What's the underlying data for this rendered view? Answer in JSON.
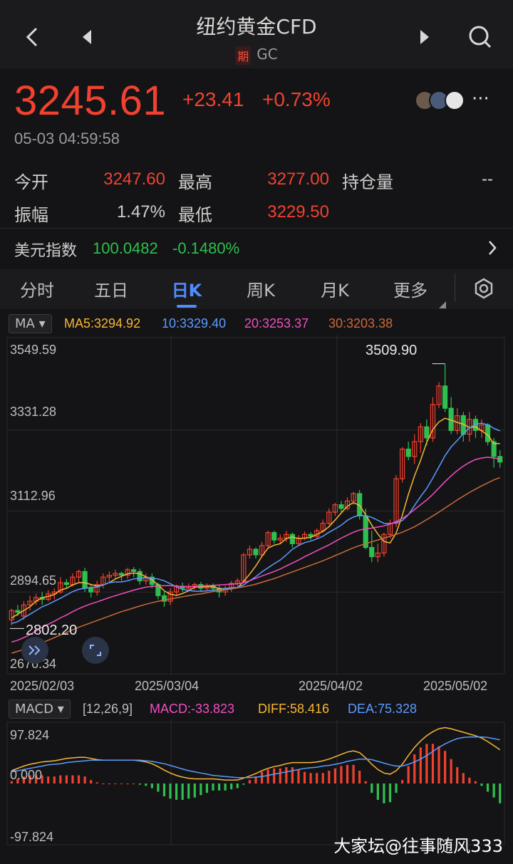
{
  "header": {
    "title": "纽约黄金CFD",
    "badge": "期",
    "code": "GC"
  },
  "quote": {
    "price": "3245.61",
    "change": "+23.41",
    "change_pct": "+0.73%",
    "timestamp": "05-03 04:59:58",
    "more": "···"
  },
  "stats": {
    "open_label": "今开",
    "open": "3247.60",
    "high_label": "最高",
    "high": "3277.00",
    "oi_label": "持仓量",
    "oi": "--",
    "amp_label": "振幅",
    "amp": "1.47%",
    "low_label": "最低",
    "low": "3229.50"
  },
  "related": {
    "label": "美元指数",
    "value": "100.0482",
    "change": "-0.1480%"
  },
  "tabs": [
    {
      "label": "分时"
    },
    {
      "label": "五日"
    },
    {
      "label": "日K"
    },
    {
      "label": "周K"
    },
    {
      "label": "月K"
    },
    {
      "label": "更多"
    }
  ],
  "main_indicator": {
    "selector": "MA",
    "ma5": "MA5:3294.92",
    "ma10": "10:3329.40",
    "ma20": "20:3253.37",
    "ma30": "30:3203.38"
  },
  "sub_indicator": {
    "selector": "MACD",
    "params": "[12,26,9]",
    "macd": "MACD:-33.823",
    "diff": "DIFF:58.416",
    "dea": "DEA:75.328"
  },
  "colors": {
    "up": "#f2412f",
    "down": "#2fbf4f",
    "ma5": "#f7b733",
    "ma10": "#5b9bff",
    "ma20": "#f04fc0",
    "ma30": "#c96a3c",
    "accent": "#4e8cff"
  },
  "icons": [
    "back-icon",
    "prev-icon",
    "next-icon",
    "search-icon",
    "settings-icon",
    "chevron-right-icon",
    "collapse-icon",
    "fullscreen-icon"
  ],
  "watermark": "大家坛@往事随风333",
  "chart_data": [
    {
      "type": "candlestick",
      "y_tick_labels": [
        "3549.59",
        "3331.28",
        "3112.96",
        "2894.65",
        "2676.34"
      ],
      "ylim": [
        2676.34,
        3549.59
      ],
      "x_tick_labels": [
        "2025/02/03",
        "2025/03/04",
        "2025/04/02",
        "2025/05/02"
      ],
      "max_marker": "3509.90",
      "min_marker": "2802.20",
      "candles": [
        [
          2820,
          2845,
          2805,
          2850
        ],
        [
          2845,
          2840,
          2830,
          2860
        ],
        [
          2830,
          2860,
          2820,
          2870
        ],
        [
          2860,
          2870,
          2845,
          2885
        ],
        [
          2870,
          2880,
          2860,
          2890
        ],
        [
          2880,
          2875,
          2860,
          2895
        ],
        [
          2875,
          2890,
          2870,
          2900
        ],
        [
          2890,
          2895,
          2875,
          2905
        ],
        [
          2895,
          2920,
          2890,
          2935
        ],
        [
          2920,
          2915,
          2905,
          2930
        ],
        [
          2915,
          2935,
          2910,
          2945
        ],
        [
          2935,
          2950,
          2920,
          2955
        ],
        [
          2950,
          2905,
          2895,
          2960
        ],
        [
          2905,
          2895,
          2880,
          2915
        ],
        [
          2895,
          2915,
          2885,
          2925
        ],
        [
          2915,
          2935,
          2905,
          2945
        ],
        [
          2935,
          2940,
          2920,
          2950
        ],
        [
          2940,
          2945,
          2930,
          2955
        ],
        [
          2945,
          2940,
          2925,
          2950
        ],
        [
          2940,
          2955,
          2930,
          2960
        ],
        [
          2955,
          2950,
          2935,
          2962
        ],
        [
          2950,
          2925,
          2915,
          2958
        ],
        [
          2925,
          2935,
          2915,
          2945
        ],
        [
          2935,
          2915,
          2905,
          2945
        ],
        [
          2915,
          2885,
          2875,
          2920
        ],
        [
          2885,
          2870,
          2855,
          2895
        ],
        [
          2870,
          2895,
          2860,
          2905
        ],
        [
          2895,
          2910,
          2885,
          2915
        ],
        [
          2910,
          2905,
          2895,
          2920
        ],
        [
          2905,
          2910,
          2898,
          2918
        ],
        [
          2910,
          2915,
          2900,
          2920
        ],
        [
          2915,
          2905,
          2895,
          2922
        ],
        [
          2905,
          2912,
          2898,
          2918
        ],
        [
          2912,
          2905,
          2895,
          2918
        ],
        [
          2905,
          2895,
          2880,
          2912
        ],
        [
          2895,
          2905,
          2885,
          2912
        ],
        [
          2905,
          2918,
          2895,
          2925
        ],
        [
          2918,
          2925,
          2910,
          2932
        ],
        [
          2925,
          2995,
          2920,
          3000
        ],
        [
          2995,
          3010,
          2985,
          3020
        ],
        [
          3010,
          2995,
          2985,
          3015
        ],
        [
          2995,
          3020,
          2990,
          3030
        ],
        [
          3020,
          3055,
          3015,
          3060
        ],
        [
          3055,
          3035,
          3025,
          3060
        ],
        [
          3035,
          3040,
          3025,
          3050
        ],
        [
          3040,
          3050,
          3030,
          3060
        ],
        [
          3050,
          3025,
          3015,
          3055
        ],
        [
          3025,
          3040,
          3020,
          3048
        ],
        [
          3040,
          3050,
          3035,
          3058
        ],
        [
          3050,
          3045,
          3035,
          3056
        ],
        [
          3045,
          3060,
          3040,
          3066
        ],
        [
          3060,
          3080,
          3055,
          3090
        ],
        [
          3080,
          3110,
          3075,
          3120
        ],
        [
          3110,
          3130,
          3100,
          3135
        ],
        [
          3130,
          3120,
          3110,
          3140
        ],
        [
          3120,
          3140,
          3115,
          3150
        ],
        [
          3140,
          3160,
          3130,
          3165
        ],
        [
          3160,
          3100,
          3090,
          3170
        ],
        [
          3100,
          3015,
          3010,
          3120
        ],
        [
          3015,
          2990,
          2975,
          3060
        ],
        [
          2990,
          3000,
          2975,
          3025
        ],
        [
          3000,
          3050,
          2990,
          3055
        ],
        [
          3050,
          3080,
          3040,
          3090
        ],
        [
          3080,
          3200,
          3070,
          3210
        ],
        [
          3200,
          3280,
          3190,
          3285
        ],
        [
          3280,
          3260,
          3250,
          3300
        ],
        [
          3260,
          3300,
          3240,
          3320
        ],
        [
          3300,
          3340,
          3270,
          3350
        ],
        [
          3340,
          3310,
          3290,
          3360
        ],
        [
          3310,
          3400,
          3300,
          3420
        ],
        [
          3400,
          3450,
          3390,
          3460
        ],
        [
          3450,
          3390,
          3380,
          3510
        ],
        [
          3390,
          3330,
          3320,
          3420
        ],
        [
          3330,
          3370,
          3320,
          3390
        ],
        [
          3370,
          3320,
          3300,
          3380
        ],
        [
          3320,
          3360,
          3300,
          3380
        ],
        [
          3360,
          3330,
          3310,
          3370
        ],
        [
          3330,
          3345,
          3310,
          3360
        ],
        [
          3345,
          3300,
          3290,
          3350
        ],
        [
          3300,
          3260,
          3230,
          3310
        ],
        [
          3260,
          3245,
          3230,
          3277
        ]
      ],
      "series": [
        {
          "name": "MA5",
          "values": [
            2825,
            2835,
            2845,
            2855,
            2870,
            2880,
            2883,
            2888,
            2900,
            2905,
            2914,
            2920,
            2920,
            2915,
            2911,
            2914,
            2920,
            2930,
            2937,
            2944,
            2946,
            2944,
            2936,
            2928,
            2914,
            2898,
            2889,
            2886,
            2891,
            2898,
            2908,
            2909,
            2909,
            2910,
            2904,
            2903,
            2905,
            2906,
            2923,
            2943,
            2965,
            2991,
            3013,
            3021,
            3025,
            3039,
            3043,
            3039,
            3040,
            3042,
            3050,
            3058,
            3071,
            3089,
            3108,
            3126,
            3136,
            3128,
            3103,
            3075,
            3051,
            3031,
            3027,
            3054,
            3101,
            3158,
            3208,
            3250,
            3298,
            3333,
            3353,
            3363,
            3358,
            3352,
            3347,
            3338,
            3340,
            3329,
            3318,
            3295,
            3295
          ]
        },
        {
          "name": "MA10",
          "values": [
            2810,
            2815,
            2825,
            2835,
            2845,
            2855,
            2862,
            2870,
            2878,
            2887,
            2896,
            2902,
            2905,
            2907,
            2908,
            2914,
            2920,
            2922,
            2922,
            2925,
            2930,
            2932,
            2933,
            2932,
            2930,
            2925,
            2917,
            2909,
            2902,
            2899,
            2897,
            2897,
            2898,
            2900,
            2901,
            2904,
            2906,
            2907,
            2914,
            2925,
            2936,
            2949,
            2960,
            2971,
            2981,
            2995,
            3010,
            3020,
            3028,
            3032,
            3038,
            3045,
            3056,
            3065,
            3075,
            3088,
            3097,
            3102,
            3100,
            3096,
            3088,
            3080,
            3079,
            3082,
            3087,
            3103,
            3128,
            3152,
            3174,
            3202,
            3232,
            3262,
            3286,
            3303,
            3322,
            3337,
            3347,
            3350,
            3345,
            3336,
            3329
          ]
        },
        {
          "name": "MA20",
          "values": [
            2760,
            2765,
            2772,
            2780,
            2790,
            2800,
            2808,
            2816,
            2825,
            2833,
            2842,
            2850,
            2857,
            2863,
            2868,
            2874,
            2880,
            2885,
            2890,
            2895,
            2900,
            2904,
            2908,
            2910,
            2911,
            2912,
            2912,
            2911,
            2910,
            2909,
            2910,
            2911,
            2912,
            2913,
            2914,
            2915,
            2916,
            2917,
            2920,
            2925,
            2932,
            2938,
            2944,
            2950,
            2957,
            2965,
            2973,
            2981,
            2990,
            2998,
            3006,
            3014,
            3022,
            3031,
            3040,
            3048,
            3056,
            3062,
            3065,
            3067,
            3070,
            3073,
            3078,
            3085,
            3093,
            3104,
            3117,
            3130,
            3143,
            3158,
            3175,
            3192,
            3208,
            3222,
            3234,
            3244,
            3252,
            3256,
            3258,
            3256,
            3253
          ]
        },
        {
          "name": "MA30",
          "values": [
            2730,
            2735,
            2740,
            2746,
            2752,
            2758,
            2765,
            2772,
            2779,
            2786,
            2793,
            2800,
            2806,
            2812,
            2818,
            2824,
            2830,
            2836,
            2842,
            2847,
            2852,
            2857,
            2862,
            2866,
            2870,
            2873,
            2876,
            2879,
            2882,
            2885,
            2888,
            2890,
            2893,
            2896,
            2898,
            2901,
            2903,
            2906,
            2909,
            2912,
            2916,
            2921,
            2926,
            2931,
            2937,
            2943,
            2949,
            2955,
            2961,
            2967,
            2973,
            2979,
            2986,
            2993,
            3000,
            3007,
            3014,
            3020,
            3025,
            3030,
            3035,
            3040,
            3045,
            3050,
            3056,
            3063,
            3071,
            3080,
            3090,
            3100,
            3110,
            3121,
            3132,
            3143,
            3153,
            3163,
            3172,
            3181,
            3189,
            3197,
            3203
          ]
        }
      ]
    },
    {
      "type": "macd",
      "y_tick_labels": [
        "97.824",
        "0.000",
        "-97.824"
      ],
      "ylim": [
        -97.824,
        97.824
      ],
      "series": [
        {
          "name": "DIFF",
          "values": [
            22,
            26,
            30,
            33,
            35,
            37,
            38,
            39,
            41,
            43,
            44,
            45,
            45,
            43,
            41,
            40,
            40,
            40,
            40,
            40,
            40,
            39,
            37,
            34,
            29,
            23,
            18,
            14,
            11,
            9,
            8,
            8,
            8,
            8,
            7,
            6,
            6,
            6,
            9,
            13,
            17,
            22,
            26,
            29,
            31,
            34,
            36,
            36,
            36,
            36,
            37,
            39,
            42,
            46,
            50,
            54,
            56,
            53,
            44,
            33,
            24,
            18,
            16,
            22,
            33,
            48,
            62,
            73,
            82,
            89,
            94,
            96,
            94,
            91,
            88,
            85,
            82,
            78,
            72,
            65,
            58
          ]
        },
        {
          "name": "DEA",
          "values": [
            20,
            22,
            24,
            26,
            28,
            30,
            32,
            33,
            34,
            36,
            37,
            38,
            39,
            40,
            40,
            40,
            40,
            40,
            40,
            40,
            40,
            40,
            39,
            38,
            36,
            34,
            31,
            28,
            25,
            22,
            20,
            18,
            16,
            14,
            13,
            12,
            11,
            10,
            10,
            10,
            11,
            12,
            14,
            16,
            18,
            20,
            22,
            24,
            26,
            27,
            28,
            30,
            31,
            33,
            35,
            38,
            40,
            42,
            42,
            41,
            38,
            35,
            32,
            30,
            30,
            33,
            37,
            42,
            48,
            55,
            62,
            68,
            73,
            77,
            79,
            80,
            80,
            80,
            79,
            77,
            75
          ]
        }
      ],
      "histogram": [
        4,
        8,
        12,
        14,
        14,
        14,
        12,
        12,
        14,
        14,
        14,
        14,
        12,
        6,
        2,
        0,
        0,
        0,
        0,
        0,
        0,
        -2,
        -4,
        -8,
        -14,
        -22,
        -26,
        -28,
        -28,
        -26,
        -24,
        -20,
        -16,
        -12,
        -12,
        -12,
        -10,
        -8,
        -2,
        6,
        12,
        20,
        24,
        26,
        26,
        28,
        28,
        24,
        20,
        18,
        18,
        18,
        22,
        26,
        30,
        32,
        32,
        22,
        4,
        -16,
        -28,
        -34,
        -32,
        -16,
        6,
        30,
        50,
        62,
        68,
        68,
        64,
        56,
        42,
        28,
        18,
        10,
        4,
        -4,
        -14,
        -24,
        -34
      ]
    }
  ]
}
